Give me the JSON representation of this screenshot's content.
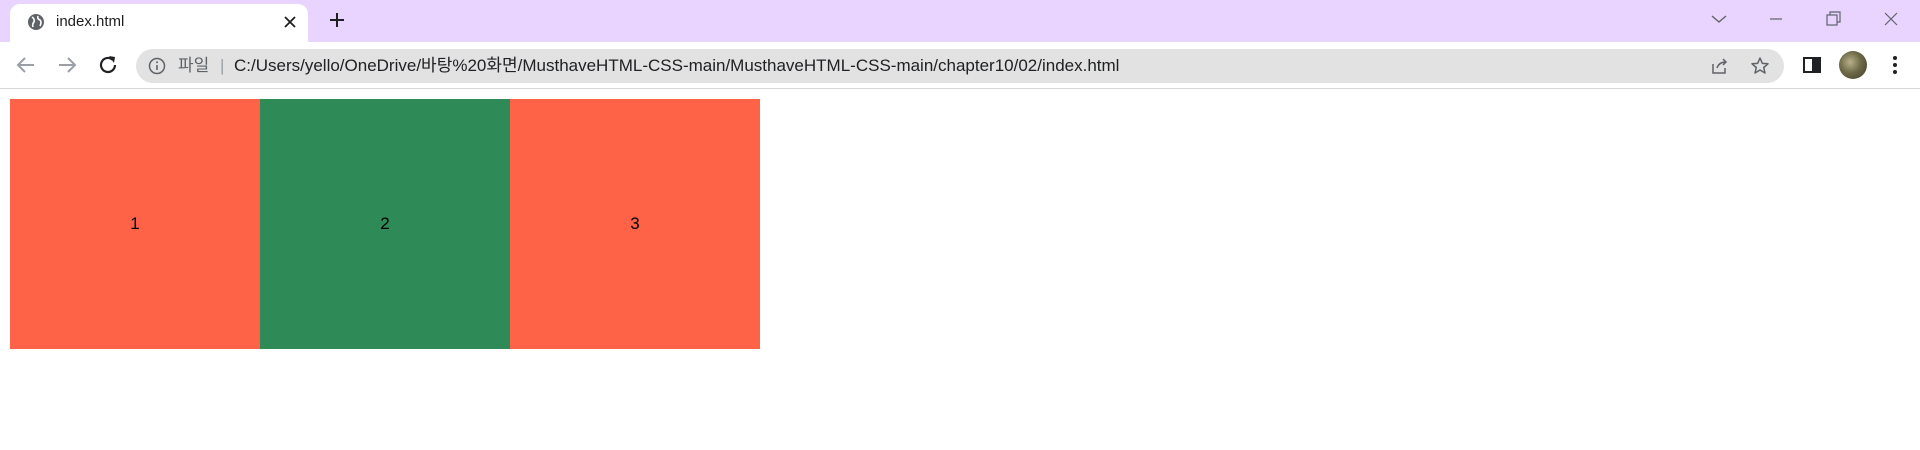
{
  "browser": {
    "tab": {
      "title": "index.html"
    },
    "address": {
      "scheme_label": "파일",
      "separator": "|",
      "url": "C:/Users/yello/OneDrive/바탕%20화면/MusthaveHTML-CSS-main/MusthaveHTML-CSS-main/chapter10/02/index.html"
    },
    "icons": [
      "globe-icon",
      "close-icon",
      "plus-icon",
      "chevron-down-icon",
      "minimize-icon",
      "restore-icon",
      "window-close-icon",
      "back-arrow-icon",
      "forward-arrow-icon",
      "reload-icon",
      "info-icon",
      "share-icon",
      "star-icon",
      "side-panel-icon",
      "avatar",
      "kebab-menu-icon"
    ]
  },
  "colors": {
    "tab_strip": "#e9d3ff",
    "box_tomato": "#ff6347",
    "box_seagreen": "#2e8b57"
  },
  "page": {
    "boxes": [
      {
        "label": "1",
        "color": "#ff6347"
      },
      {
        "label": "2",
        "color": "#2e8b57"
      },
      {
        "label": "3",
        "color": "#ff6347"
      }
    ]
  }
}
